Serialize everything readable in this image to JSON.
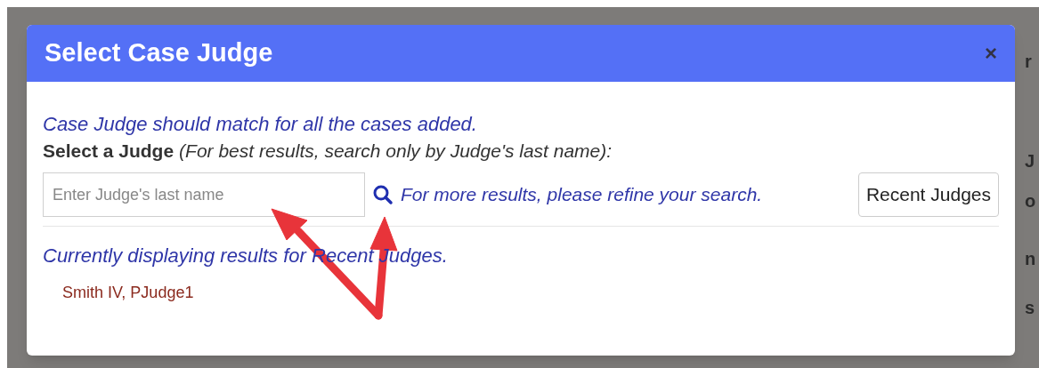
{
  "background_fragments": [
    "r",
    "J",
    "o",
    "n",
    "s"
  ],
  "dialog": {
    "title": "Select Case Judge",
    "close": "×",
    "note": "Case Judge should match for all the cases added.",
    "prompt_label": "Select a Judge",
    "prompt_hint": "(For best results, search only by Judge's last name):",
    "search": {
      "placeholder": "Enter Judge's last name"
    },
    "refine_hint": "For more results, please refine your search.",
    "recent_button": "Recent Judges",
    "results_caption": "Currently displaying results for Recent Judges.",
    "judges": [
      "Smith IV, PJudge1"
    ]
  }
}
